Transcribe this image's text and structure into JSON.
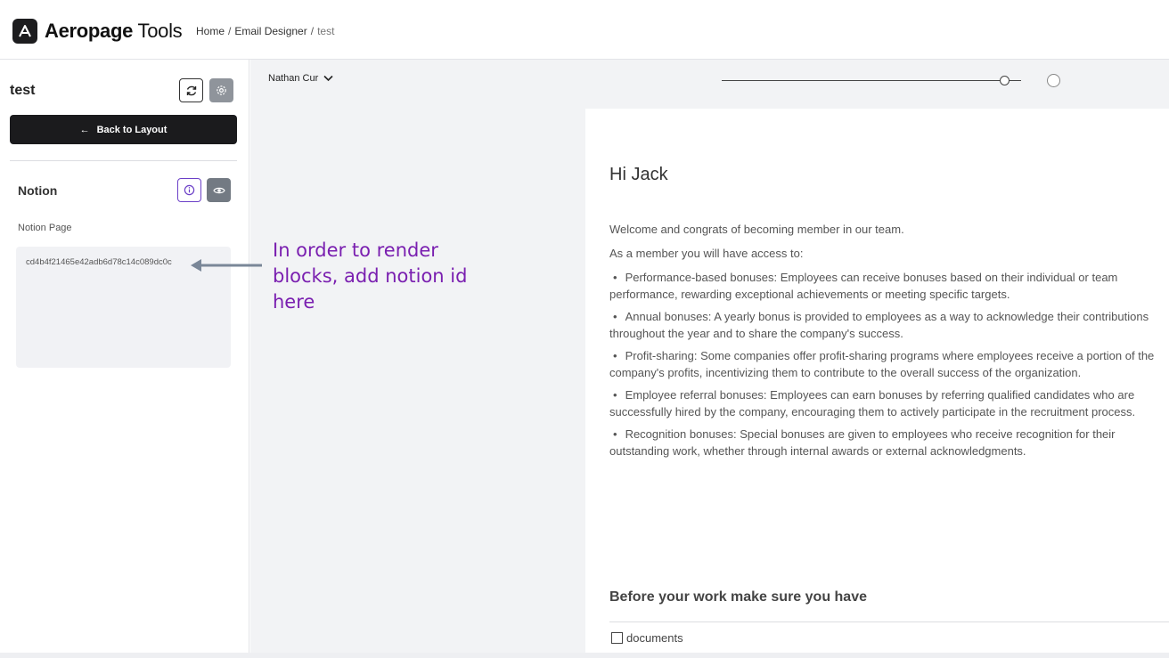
{
  "header": {
    "logo_bold": "Aeropage",
    "logo_light": "Tools",
    "breadcrumb": [
      "Home",
      "Email Designer",
      "test"
    ]
  },
  "sidebar": {
    "title": "test",
    "back_label": "Back to Layout",
    "section_title": "Notion",
    "notion_page_label": "Notion Page",
    "notion_id_value": "cd4b4f21465e42adb6d78c14c089dc0c"
  },
  "toolbar": {
    "user": "Nathan Cur"
  },
  "email": {
    "greeting": "Hi Jack",
    "welcome": "Welcome and congrats of becoming member in our team.",
    "access": "As a member you will have access to:",
    "bullets": [
      "Performance-based bonuses: Employees can receive bonuses based on their individual or team performance, rewarding exceptional achievements or meeting specific targets.",
      "Annual bonuses: A yearly bonus is provided to employees as a way to acknowledge their contributions throughout the year and to share the company's success.",
      "Profit-sharing: Some companies offer profit-sharing programs where employees receive a portion of the company's profits, incentivizing them to contribute to the overall success of the organization.",
      "Employee referral bonuses: Employees can earn bonuses by referring qualified candidates who are successfully hired by the company, encouraging them to actively participate in the recruitment process.",
      "Recognition bonuses: Special bonuses are given to employees who receive recognition for their outstanding work, whether through internal awards or external acknowledgments."
    ],
    "before_heading": "Before your work make sure you have",
    "checklist_item": "documents"
  },
  "annotation": {
    "text": "In order to render blocks, add notion id here"
  },
  "colors": {
    "accent_purple": "#7a1fb0",
    "dark_button": "#1b1b1d",
    "canvas_bg": "#f2f3f5"
  }
}
